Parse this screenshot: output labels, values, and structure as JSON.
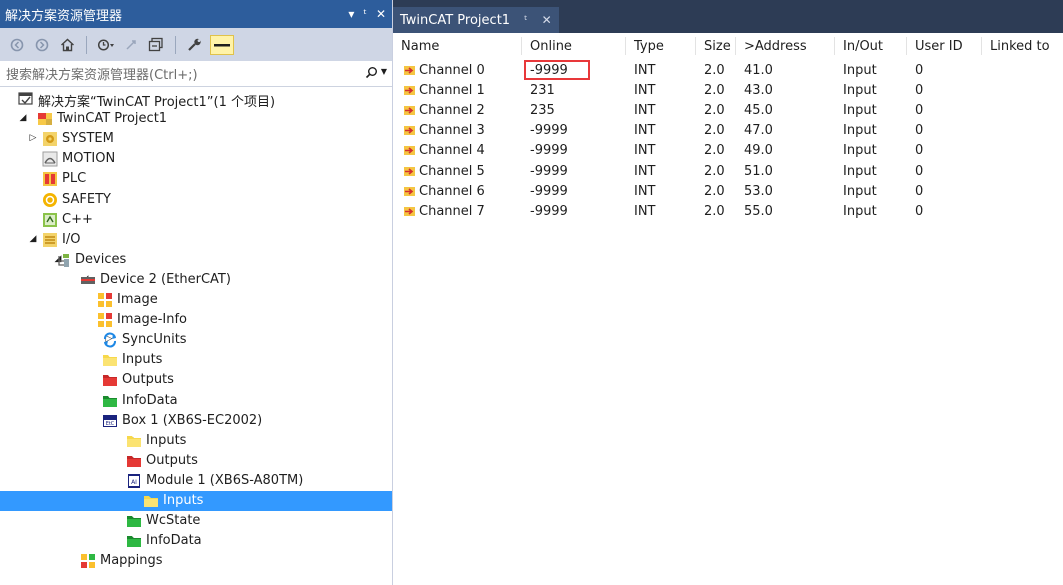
{
  "explorer": {
    "title": "解决方案资源管理器",
    "controls": {
      "dropdown": "▾",
      "pin": "ᵗ",
      "close": "✕"
    },
    "search_placeholder": "搜索解决方案资源管理器(Ctrl+;)",
    "toolbar_icons": [
      "back-icon",
      "forward-icon",
      "home-icon",
      "history-icon",
      "sync-icon",
      "collapse-all-icon",
      "properties-icon",
      "preview-icon"
    ],
    "tree": [
      {
        "label": "解决方案“TwinCAT Project1”(1 个项目)",
        "icon": "solution-icon",
        "toggle": ""
      },
      {
        "label": "TwinCAT Project1",
        "icon": "twincat-project-icon",
        "toggle": "◢"
      },
      {
        "label": "SYSTEM",
        "icon": "system-icon",
        "toggle": "▷"
      },
      {
        "label": "MOTION",
        "icon": "motion-icon",
        "toggle": ""
      },
      {
        "label": "PLC",
        "icon": "plc-icon",
        "toggle": ""
      },
      {
        "label": "SAFETY",
        "icon": "safety-icon",
        "toggle": ""
      },
      {
        "label": "C++",
        "icon": "cpp-icon",
        "toggle": ""
      },
      {
        "label": "I/O",
        "icon": "io-icon",
        "toggle": "◢"
      },
      {
        "label": "Devices",
        "icon": "devices-icon",
        "toggle": "◢"
      },
      {
        "label": "Device 2 (EtherCAT)",
        "icon": "ethercat-device-icon",
        "toggle": "◢"
      },
      {
        "label": "Image",
        "icon": "image-icon",
        "toggle": ""
      },
      {
        "label": "Image-Info",
        "icon": "image-info-icon",
        "toggle": ""
      },
      {
        "label": "SyncUnits",
        "icon": "sync-units-icon",
        "toggle": "▷"
      },
      {
        "label": "Inputs",
        "icon": "inputs-folder-icon",
        "toggle": "▷"
      },
      {
        "label": "Outputs",
        "icon": "outputs-folder-icon",
        "toggle": "▷"
      },
      {
        "label": "InfoData",
        "icon": "infodata-folder-icon",
        "toggle": "▷"
      },
      {
        "label": "Box 1 (XB6S-EC2002)",
        "icon": "box-icon",
        "toggle": "◢"
      },
      {
        "label": "Inputs",
        "icon": "inputs-folder-icon",
        "toggle": "▷"
      },
      {
        "label": "Outputs",
        "icon": "outputs-folder-icon",
        "toggle": "▷"
      },
      {
        "label": "Module 1 (XB6S-A80TM)",
        "icon": "module-icon",
        "toggle": "◢"
      },
      {
        "label": "Inputs",
        "icon": "inputs-folder-icon",
        "toggle": "▷",
        "selected": true
      },
      {
        "label": "WcState",
        "icon": "wcstate-folder-icon",
        "toggle": "▷"
      },
      {
        "label": "InfoData",
        "icon": "infodata-folder-icon",
        "toggle": "▷"
      },
      {
        "label": "Mappings",
        "icon": "mappings-icon",
        "toggle": ""
      }
    ]
  },
  "document": {
    "tab_title": "TwinCAT Project1",
    "tab_pin": "ᵗ",
    "tab_close": "✕",
    "columns": [
      "Name",
      "Online",
      "Type",
      "Size",
      ">Address",
      "In/Out",
      "User ID",
      "Linked to"
    ],
    "rows": [
      {
        "name": "Channel 0",
        "online": "-9999",
        "type": "INT",
        "size": "2.0",
        "address": "41.0",
        "inout": "Input",
        "userid": "0",
        "linked": ""
      },
      {
        "name": "Channel 1",
        "online": "231",
        "type": "INT",
        "size": "2.0",
        "address": "43.0",
        "inout": "Input",
        "userid": "0",
        "linked": ""
      },
      {
        "name": "Channel 2",
        "online": "235",
        "type": "INT",
        "size": "2.0",
        "address": "45.0",
        "inout": "Input",
        "userid": "0",
        "linked": ""
      },
      {
        "name": "Channel 3",
        "online": "-9999",
        "type": "INT",
        "size": "2.0",
        "address": "47.0",
        "inout": "Input",
        "userid": "0",
        "linked": ""
      },
      {
        "name": "Channel 4",
        "online": "-9999",
        "type": "INT",
        "size": "2.0",
        "address": "49.0",
        "inout": "Input",
        "userid": "0",
        "linked": ""
      },
      {
        "name": "Channel 5",
        "online": "-9999",
        "type": "INT",
        "size": "2.0",
        "address": "51.0",
        "inout": "Input",
        "userid": "0",
        "linked": ""
      },
      {
        "name": "Channel 6",
        "online": "-9999",
        "type": "INT",
        "size": "2.0",
        "address": "53.0",
        "inout": "Input",
        "userid": "0",
        "linked": ""
      },
      {
        "name": "Channel 7",
        "online": "-9999",
        "type": "INT",
        "size": "2.0",
        "address": "55.0",
        "inout": "Input",
        "userid": "0",
        "linked": ""
      }
    ],
    "highlighted_cell": "Channel 0 online value",
    "colors": {
      "highlight_border": "#e8383a",
      "selection": "#3399ff",
      "title_bar": "#2d5d9c",
      "tab_strip": "#2d3c55"
    }
  }
}
